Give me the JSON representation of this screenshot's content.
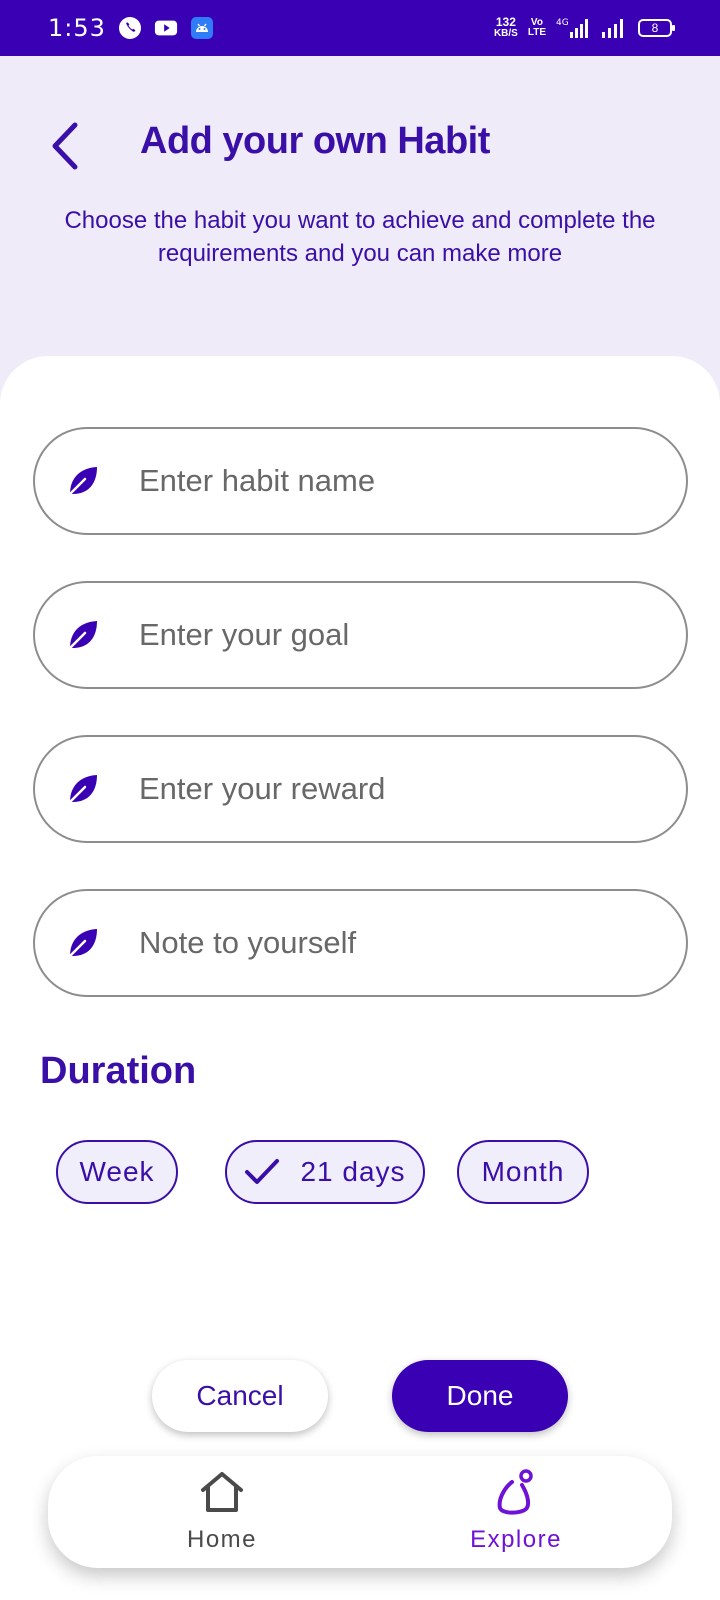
{
  "status_bar": {
    "time": "1:53",
    "network_speed_value": "132",
    "network_speed_unit": "KB/S",
    "volte_top": "Vo",
    "volte_bottom": "LTE",
    "network_type": "4G",
    "battery_level": "8",
    "icons": [
      "phone-icon",
      "youtube-icon",
      "android-app-icon",
      "signal-icon",
      "battery-icon"
    ]
  },
  "header": {
    "title": "Add your own Habit",
    "subtitle": "Choose the habit you want to achieve and complete the requirements and you can make more"
  },
  "form": {
    "fields": [
      {
        "placeholder": "Enter habit name",
        "icon": "leaf-icon"
      },
      {
        "placeholder": "Enter your goal",
        "icon": "leaf-icon"
      },
      {
        "placeholder": "Enter your reward",
        "icon": "leaf-icon"
      },
      {
        "placeholder": "Note to yourself",
        "icon": "leaf-icon"
      }
    ]
  },
  "duration": {
    "title": "Duration",
    "options": [
      {
        "label": "Week",
        "selected": false
      },
      {
        "label": "21 days",
        "selected": true
      },
      {
        "label": "Month",
        "selected": false
      }
    ]
  },
  "actions": {
    "cancel_label": "Cancel",
    "done_label": "Done"
  },
  "bottom_nav": {
    "items": [
      {
        "label": "Home",
        "icon": "home-icon",
        "active": false
      },
      {
        "label": "Explore",
        "icon": "explore-icon",
        "active": true
      }
    ]
  },
  "colors": {
    "primary": "#3a00b4",
    "accent_text": "#3a0fa8",
    "explore_active": "#6f12d8",
    "background": "#efebf9"
  }
}
